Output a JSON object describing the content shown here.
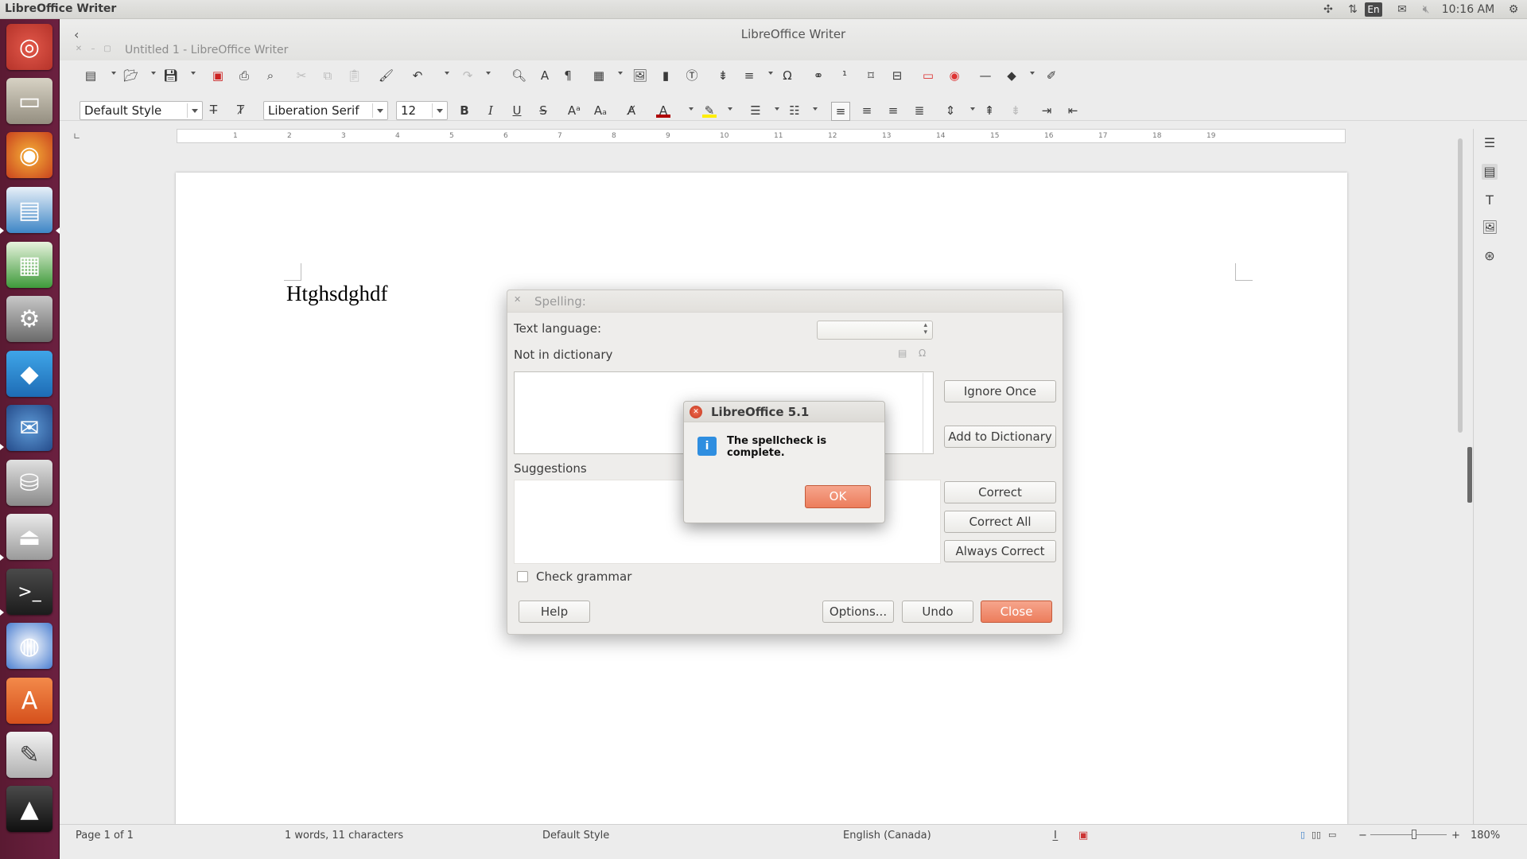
{
  "topbar": {
    "app_name": "LibreOffice Writer",
    "keyboard_layout": "En",
    "clock": "10:16 AM"
  },
  "window": {
    "title": "LibreOffice Writer",
    "document_title": "Untitled 1 - LibreOffice Writer"
  },
  "formatting": {
    "paragraph_style": "Default Style",
    "font_name": "Liberation Serif",
    "font_size": "12"
  },
  "document": {
    "text": "Htghsdghdf"
  },
  "ruler": {
    "numbers": [
      "1",
      "2",
      "3",
      "4",
      "5",
      "6",
      "7",
      "8",
      "9",
      "10",
      "11",
      "12",
      "13",
      "14",
      "15",
      "16",
      "17",
      "18",
      "19"
    ]
  },
  "statusbar": {
    "page": "Page 1 of 1",
    "count": "1 words, 11 characters",
    "style": "Default Style",
    "language": "English (Canada)",
    "zoom": "180%"
  },
  "spelling_dialog": {
    "title": "Spelling:",
    "text_language_label": "Text language:",
    "text_language_value": "",
    "not_in_dictionary_label": "Not in dictionary",
    "suggestions_label": "Suggestions",
    "check_grammar_label": "Check grammar",
    "check_grammar_checked": false,
    "buttons": {
      "ignore_once": "Ignore Once",
      "add_to_dictionary": "Add to Dictionary",
      "correct": "Correct",
      "correct_all": "Correct All",
      "always_correct": "Always Correct",
      "help": "Help",
      "options": "Options...",
      "undo": "Undo",
      "close": "Close"
    }
  },
  "alert_dialog": {
    "title": "LibreOffice 5.1",
    "message": "The spellcheck is complete.",
    "ok": "OK"
  },
  "colors": {
    "launcher": "#5e1c36",
    "accent_orange": "#ec7d5c",
    "panel": "#dfdfdb"
  }
}
